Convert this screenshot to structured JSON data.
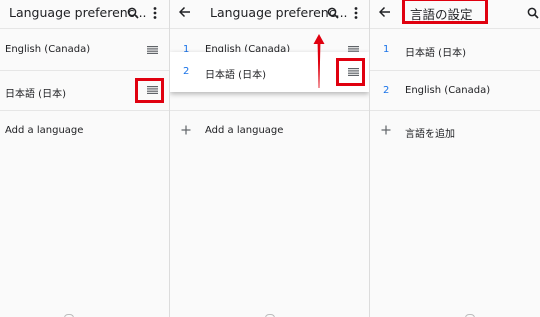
{
  "panel1": {
    "title": "Language preferenc...",
    "languages": [
      "English (Canada)",
      "日本語 (日本)"
    ],
    "add_label": "Add a language"
  },
  "panel2": {
    "title": "Language preferenc...",
    "languages": [
      {
        "num": "1",
        "label": "English (Canada)"
      },
      {
        "num": "2",
        "label": "日本語 (日本)"
      }
    ],
    "add_label": "Add a language"
  },
  "panel3": {
    "title": "言語の設定",
    "languages": [
      {
        "num": "1",
        "label": "日本語 (日本)"
      },
      {
        "num": "2",
        "label": "English (Canada)"
      }
    ],
    "add_label": "言語を追加"
  },
  "icons": {
    "search": "search-icon",
    "more": "more-vert-icon",
    "back": "arrow-back-icon",
    "drag": "drag-handle-icon",
    "add": "add-icon",
    "arrow": "up-arrow-icon"
  },
  "colors": {
    "highlight": "#e0000f",
    "accent": "#1a73e8",
    "background": "#fafafa"
  }
}
